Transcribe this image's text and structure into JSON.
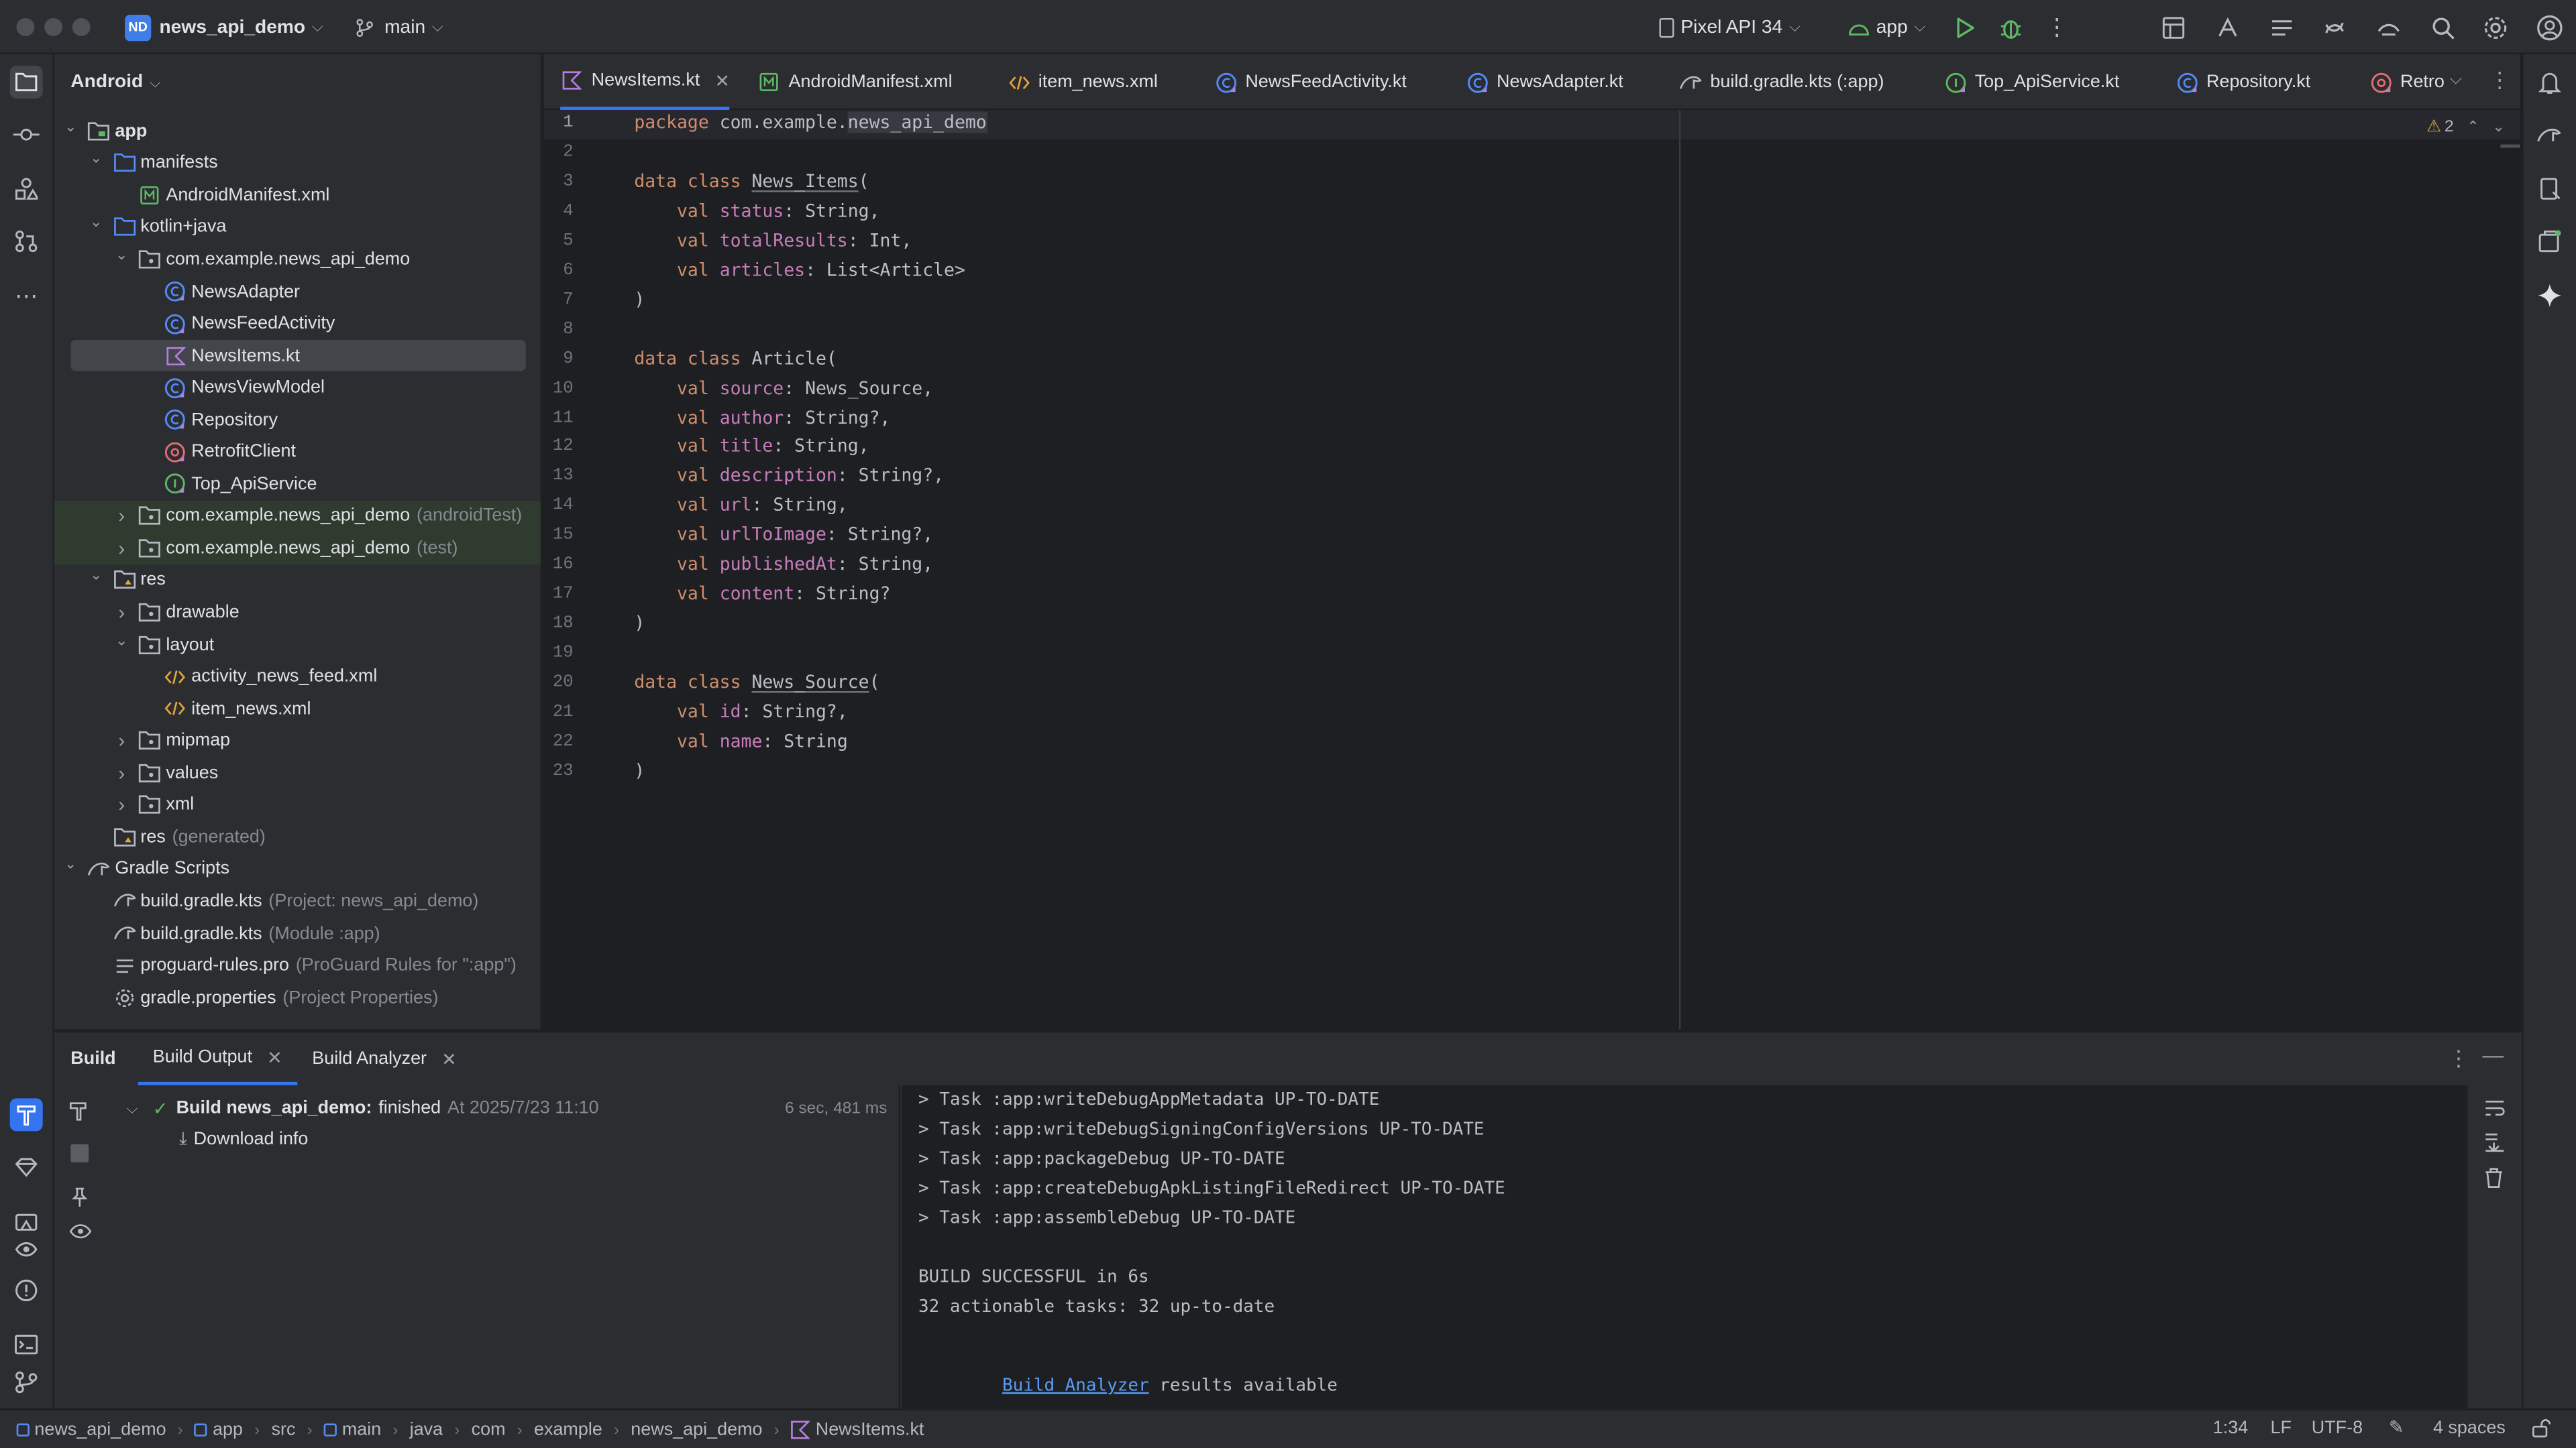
{
  "colors": {
    "accent": "#3574f0",
    "success": "#5fb865",
    "warning": "#e2a63b",
    "link": "#589df6"
  },
  "titlebar": {
    "project_badge": "ND",
    "project_name": "news_api_demo",
    "branch": "main",
    "device": "Pixel API 34",
    "run_config": "app"
  },
  "project_panel": {
    "view_label": "Android",
    "tree": [
      {
        "label": "app",
        "suffix": "",
        "icon": "module-folder-icon",
        "expand": "open"
      },
      {
        "label": "manifests",
        "suffix": "",
        "icon": "folder-icon",
        "expand": "open"
      },
      {
        "label": "AndroidManifest.xml",
        "suffix": "",
        "icon": "manifest-file-icon",
        "expand": "none"
      },
      {
        "label": "kotlin+java",
        "suffix": "",
        "icon": "folder-icon",
        "expand": "open"
      },
      {
        "label": "com.example.news_api_demo",
        "suffix": "",
        "icon": "package-icon",
        "expand": "open"
      },
      {
        "label": "NewsAdapter",
        "suffix": "",
        "icon": "kotlin-class-icon",
        "expand": "none"
      },
      {
        "label": "NewsFeedActivity",
        "suffix": "",
        "icon": "kotlin-class-icon",
        "expand": "none"
      },
      {
        "label": "NewsItems.kt",
        "suffix": "",
        "icon": "kotlin-file-icon",
        "expand": "none"
      },
      {
        "label": "NewsViewModel",
        "suffix": "",
        "icon": "kotlin-class-icon",
        "expand": "none"
      },
      {
        "label": "Repository",
        "suffix": "",
        "icon": "kotlin-class-icon",
        "expand": "none"
      },
      {
        "label": "RetrofitClient",
        "suffix": "",
        "icon": "kotlin-object-icon",
        "expand": "none"
      },
      {
        "label": "Top_ApiService",
        "suffix": "",
        "icon": "kotlin-interface-icon",
        "expand": "none"
      },
      {
        "label": "com.example.news_api_demo",
        "suffix": "(androidTest)",
        "icon": "package-icon",
        "expand": "closed"
      },
      {
        "label": "com.example.news_api_demo",
        "suffix": "(test)",
        "icon": "package-icon",
        "expand": "closed"
      },
      {
        "label": "res",
        "suffix": "",
        "icon": "res-folder-icon",
        "expand": "open"
      },
      {
        "label": "drawable",
        "suffix": "",
        "icon": "package-icon",
        "expand": "closed"
      },
      {
        "label": "layout",
        "suffix": "",
        "icon": "package-icon",
        "expand": "open"
      },
      {
        "label": "activity_news_feed.xml",
        "suffix": "",
        "icon": "xml-file-icon",
        "expand": "none"
      },
      {
        "label": "item_news.xml",
        "suffix": "",
        "icon": "xml-file-icon",
        "expand": "none"
      },
      {
        "label": "mipmap",
        "suffix": "",
        "icon": "package-icon",
        "expand": "closed"
      },
      {
        "label": "values",
        "suffix": "",
        "icon": "package-icon",
        "expand": "closed"
      },
      {
        "label": "xml",
        "suffix": "",
        "icon": "package-icon",
        "expand": "closed"
      },
      {
        "label": "res",
        "suffix": "(generated)",
        "icon": "res-folder-icon",
        "expand": "none"
      },
      {
        "label": "Gradle Scripts",
        "suffix": "",
        "icon": "gradle-icon",
        "expand": "open"
      },
      {
        "label": "build.gradle.kts",
        "suffix": "(Project: news_api_demo)",
        "icon": "gradle-file-icon",
        "expand": "none"
      },
      {
        "label": "build.gradle.kts",
        "suffix": "(Module :app)",
        "icon": "gradle-file-icon",
        "expand": "none"
      },
      {
        "label": "proguard-rules.pro",
        "suffix": "(ProGuard Rules for \":app\")",
        "icon": "text-file-icon",
        "expand": "none"
      },
      {
        "label": "gradle.properties",
        "suffix": "(Project Properties)",
        "icon": "settings-file-icon",
        "expand": "none"
      }
    ]
  },
  "tabs": [
    {
      "label": "NewsItems.kt",
      "icon": "kotlin-file-icon",
      "active": true
    },
    {
      "label": "AndroidManifest.xml",
      "icon": "manifest-file-icon",
      "active": false
    },
    {
      "label": "item_news.xml",
      "icon": "xml-file-icon",
      "active": false
    },
    {
      "label": "NewsFeedActivity.kt",
      "icon": "kotlin-class-icon",
      "active": false
    },
    {
      "label": "NewsAdapter.kt",
      "icon": "kotlin-class-icon",
      "active": false
    },
    {
      "label": "build.gradle.kts (:app)",
      "icon": "gradle-file-icon",
      "active": false
    },
    {
      "label": "Top_ApiService.kt",
      "icon": "kotlin-interface-icon",
      "active": false
    },
    {
      "label": "Repository.kt",
      "icon": "kotlin-class-icon",
      "active": false
    },
    {
      "label": "Retro",
      "icon": "kotlin-object-icon",
      "active": false
    }
  ],
  "editor": {
    "warning_count": "2",
    "lines": [
      [
        {
          "t": "package ",
          "c": "kw"
        },
        {
          "t": "com.example.",
          "c": ""
        },
        {
          "t": "news_api_demo",
          "c": "hl"
        }
      ],
      [],
      [
        {
          "t": "data class ",
          "c": "kw"
        },
        {
          "t": "News_Items",
          "c": "und"
        },
        {
          "t": "(",
          "c": ""
        }
      ],
      [
        {
          "t": "    val ",
          "c": "kw"
        },
        {
          "t": "status",
          "c": "prop"
        },
        {
          "t": ": String,",
          "c": ""
        }
      ],
      [
        {
          "t": "    val ",
          "c": "kw"
        },
        {
          "t": "totalResults",
          "c": "prop"
        },
        {
          "t": ": Int,",
          "c": ""
        }
      ],
      [
        {
          "t": "    val ",
          "c": "kw"
        },
        {
          "t": "articles",
          "c": "prop"
        },
        {
          "t": ": List<Article>",
          "c": ""
        }
      ],
      [
        {
          "t": ")",
          "c": ""
        }
      ],
      [],
      [
        {
          "t": "data class ",
          "c": "kw"
        },
        {
          "t": "Article",
          "c": ""
        },
        {
          "t": "(",
          "c": ""
        }
      ],
      [
        {
          "t": "    val ",
          "c": "kw"
        },
        {
          "t": "source",
          "c": "prop"
        },
        {
          "t": ": News_Source,",
          "c": ""
        }
      ],
      [
        {
          "t": "    val ",
          "c": "kw"
        },
        {
          "t": "author",
          "c": "prop"
        },
        {
          "t": ": String?,",
          "c": ""
        }
      ],
      [
        {
          "t": "    val ",
          "c": "kw"
        },
        {
          "t": "title",
          "c": "prop"
        },
        {
          "t": ": String,",
          "c": ""
        }
      ],
      [
        {
          "t": "    val ",
          "c": "kw"
        },
        {
          "t": "description",
          "c": "prop"
        },
        {
          "t": ": String?,",
          "c": ""
        }
      ],
      [
        {
          "t": "    val ",
          "c": "kw"
        },
        {
          "t": "url",
          "c": "prop"
        },
        {
          "t": ": String,",
          "c": ""
        }
      ],
      [
        {
          "t": "    val ",
          "c": "kw"
        },
        {
          "t": "urlToImage",
          "c": "prop"
        },
        {
          "t": ": String?,",
          "c": ""
        }
      ],
      [
        {
          "t": "    val ",
          "c": "kw"
        },
        {
          "t": "publishedAt",
          "c": "prop"
        },
        {
          "t": ": String,",
          "c": ""
        }
      ],
      [
        {
          "t": "    val ",
          "c": "kw"
        },
        {
          "t": "content",
          "c": "prop"
        },
        {
          "t": ": String?",
          "c": ""
        }
      ],
      [
        {
          "t": ")",
          "c": ""
        }
      ],
      [],
      [
        {
          "t": "data class ",
          "c": "kw"
        },
        {
          "t": "News_Source",
          "c": "und"
        },
        {
          "t": "(",
          "c": ""
        }
      ],
      [
        {
          "t": "    val ",
          "c": "kw"
        },
        {
          "t": "id",
          "c": "prop"
        },
        {
          "t": ": String?,",
          "c": ""
        }
      ],
      [
        {
          "t": "    val ",
          "c": "kw"
        },
        {
          "t": "name",
          "c": "prop"
        },
        {
          "t": ": String",
          "c": ""
        }
      ],
      [
        {
          "t": ")",
          "c": ""
        }
      ]
    ]
  },
  "build_panel": {
    "title": "Build",
    "tab_output": "Build Output",
    "tab_analyzer": "Build Analyzer",
    "result_bold": "Build news_api_demo:",
    "result_status": "finished",
    "result_time": "At 2025/7/23 11:10",
    "duration": "6 sec, 481 ms",
    "download_info": "Download info",
    "console": [
      "> Task :app:writeDebugAppMetadata UP-TO-DATE",
      "> Task :app:writeDebugSigningConfigVersions UP-TO-DATE",
      "> Task :app:packageDebug UP-TO-DATE",
      "> Task :app:createDebugApkListingFileRedirect UP-TO-DATE",
      "> Task :app:assembleDebug UP-TO-DATE",
      "",
      "BUILD SUCCESSFUL in 6s",
      "32 actionable tasks: 32 up-to-date",
      ""
    ],
    "analyzer_link": "Build Analyzer",
    "analyzer_rest": " results available"
  },
  "statusbar": {
    "breadcrumbs": [
      "news_api_demo",
      "app",
      "src",
      "main",
      "java",
      "com",
      "example",
      "news_api_demo",
      "NewsItems.kt"
    ],
    "position": "1:34",
    "line_sep": "LF",
    "encoding": "UTF-8",
    "indent": "4 spaces"
  }
}
